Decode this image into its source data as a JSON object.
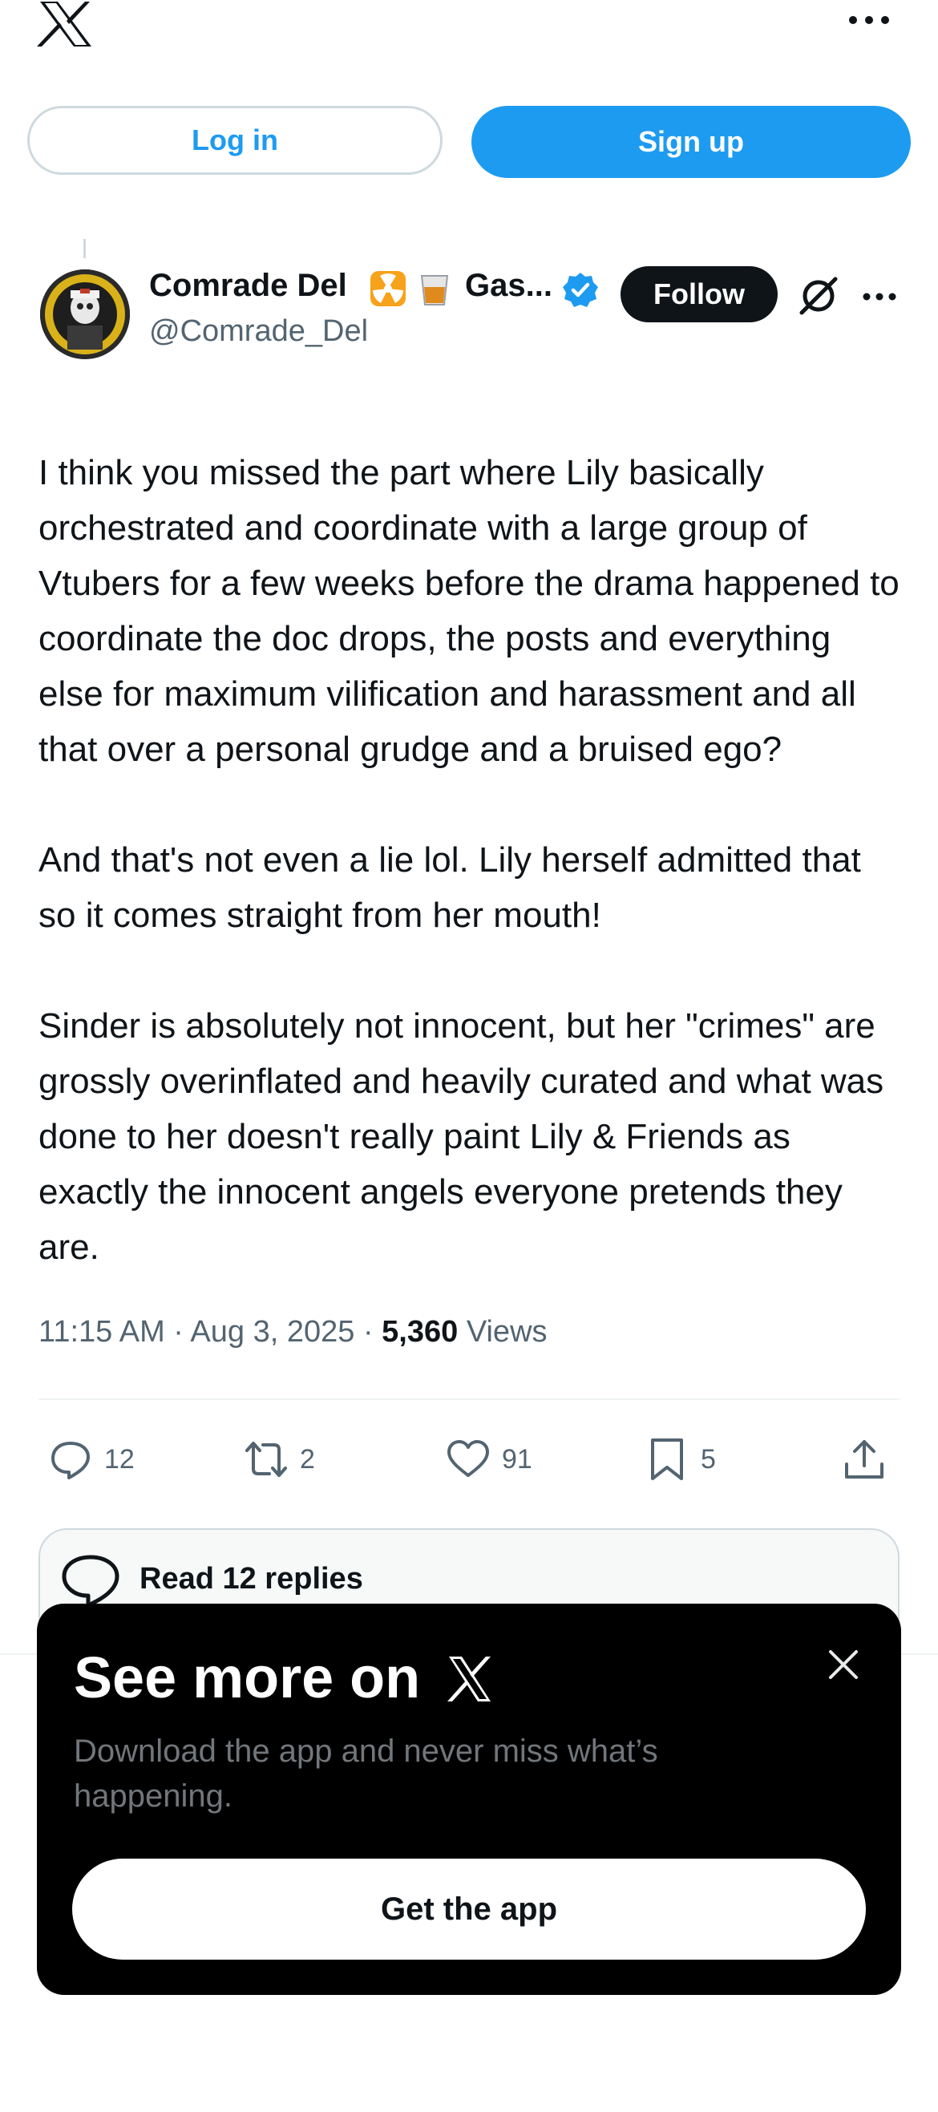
{
  "header": {
    "logo_icon": "x-logo-icon",
    "more_icon": "more-horizontal-icon",
    "login_label": "Log in",
    "signup_label": "Sign up"
  },
  "post": {
    "display_name": "Comrade Del",
    "name_emojis": [
      "radioactive-emoji",
      "glass-emoji"
    ],
    "name_truncated": "Gas...",
    "handle": "@Comrade_Del",
    "follow_label": "Follow",
    "paragraphs": [
      "I think you missed the part where Lily basically orchestrated and coordinate with a large group of Vtubers for a few weeks before the drama happened to coordinate the doc drops, the posts and everything else for maximum vilification and harassment and all that over a personal grudge and a bruised ego?",
      "And that's not even a lie lol. Lily herself admitted that so it comes straight from her mouth!",
      "Sinder is absolutely not innocent, but her \"crimes\" are grossly overinflated and heavily curated and what was done to her doesn't really paint Lily & Friends as exactly the innocent angels everyone pretends they are."
    ],
    "time": "11:15 AM",
    "date": "Aug 3, 2025",
    "views_count": "5,360",
    "views_label": "Views",
    "actions": {
      "replies": "12",
      "reposts": "2",
      "likes": "91",
      "bookmarks": "5"
    },
    "read_replies_label": "Read 12 replies"
  },
  "promo": {
    "title": "See more on",
    "subtitle": "Download the app and never miss what’s happening.",
    "cta_label": "Get the app"
  },
  "colors": {
    "accent": "#1d9bf0",
    "text": "#0f1419",
    "secondary": "#536471",
    "sheet_bg": "#000000"
  }
}
